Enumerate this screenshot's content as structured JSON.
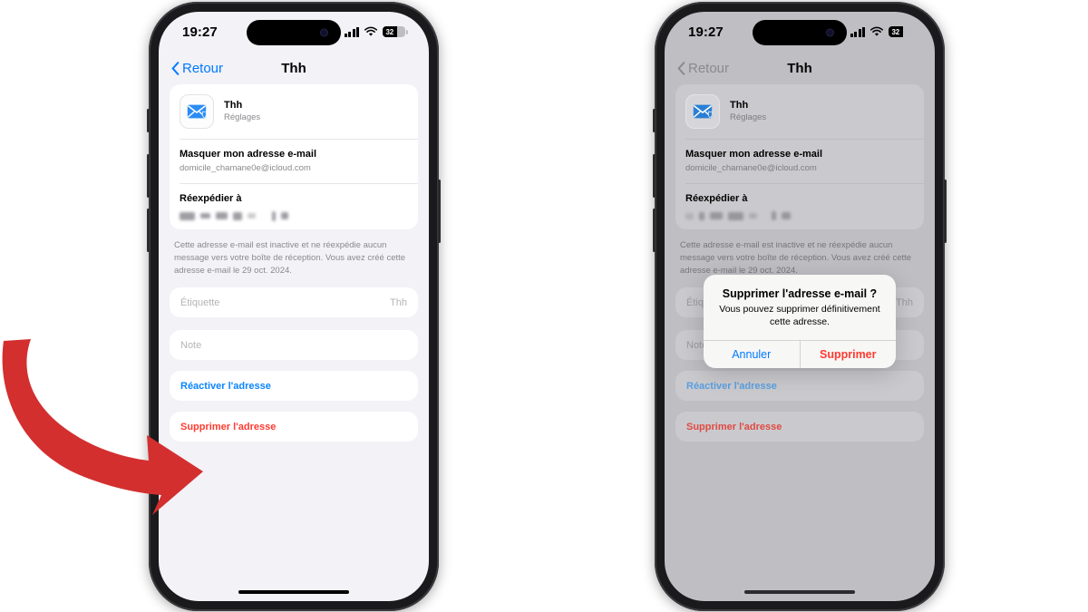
{
  "status_bar": {
    "time": "19:27",
    "cellular_icon": "cellular-signal-icon",
    "wifi_icon": "wifi-icon",
    "battery_icon": "battery-icon",
    "battery_level": "32"
  },
  "nav": {
    "back_label": "Retour",
    "back_icon": "chevron-left-icon",
    "title": "Thh"
  },
  "app_card": {
    "icon": "shielded-envelope-icon",
    "name": "Thh",
    "subtitle": "Réglages"
  },
  "hide_email": {
    "label": "Masquer mon adresse e-mail",
    "value": "domicile_chamane0e@icloud.com"
  },
  "forward_to": {
    "label": "Réexpédier à",
    "value_redacted": true
  },
  "footnote": "Cette adresse e-mail est inactive et ne réexpédie aucun message vers votre boîte de réception. Vous avez créé cette adresse e-mail le 29 oct. 2024.",
  "label_field": {
    "placeholder": "Étiquette",
    "value": "Thh"
  },
  "note_field": {
    "placeholder": "Note",
    "value": ""
  },
  "actions": {
    "reactivate": "Réactiver l'adresse",
    "delete": "Supprimer l'adresse"
  },
  "alert": {
    "title": "Supprimer l'adresse e-mail ?",
    "message": "Vous pouvez supprimer définitivement cette adresse.",
    "cancel_label": "Annuler",
    "confirm_label": "Supprimer"
  },
  "annotation": {
    "arrow_icon": "curved-arrow-icon",
    "arrow_color": "#d32f2f"
  },
  "colors": {
    "accent_blue": "#007aff",
    "destructive_red": "#ff3b30",
    "screen_bg": "#f2f2f7",
    "card_bg": "#ffffff"
  }
}
